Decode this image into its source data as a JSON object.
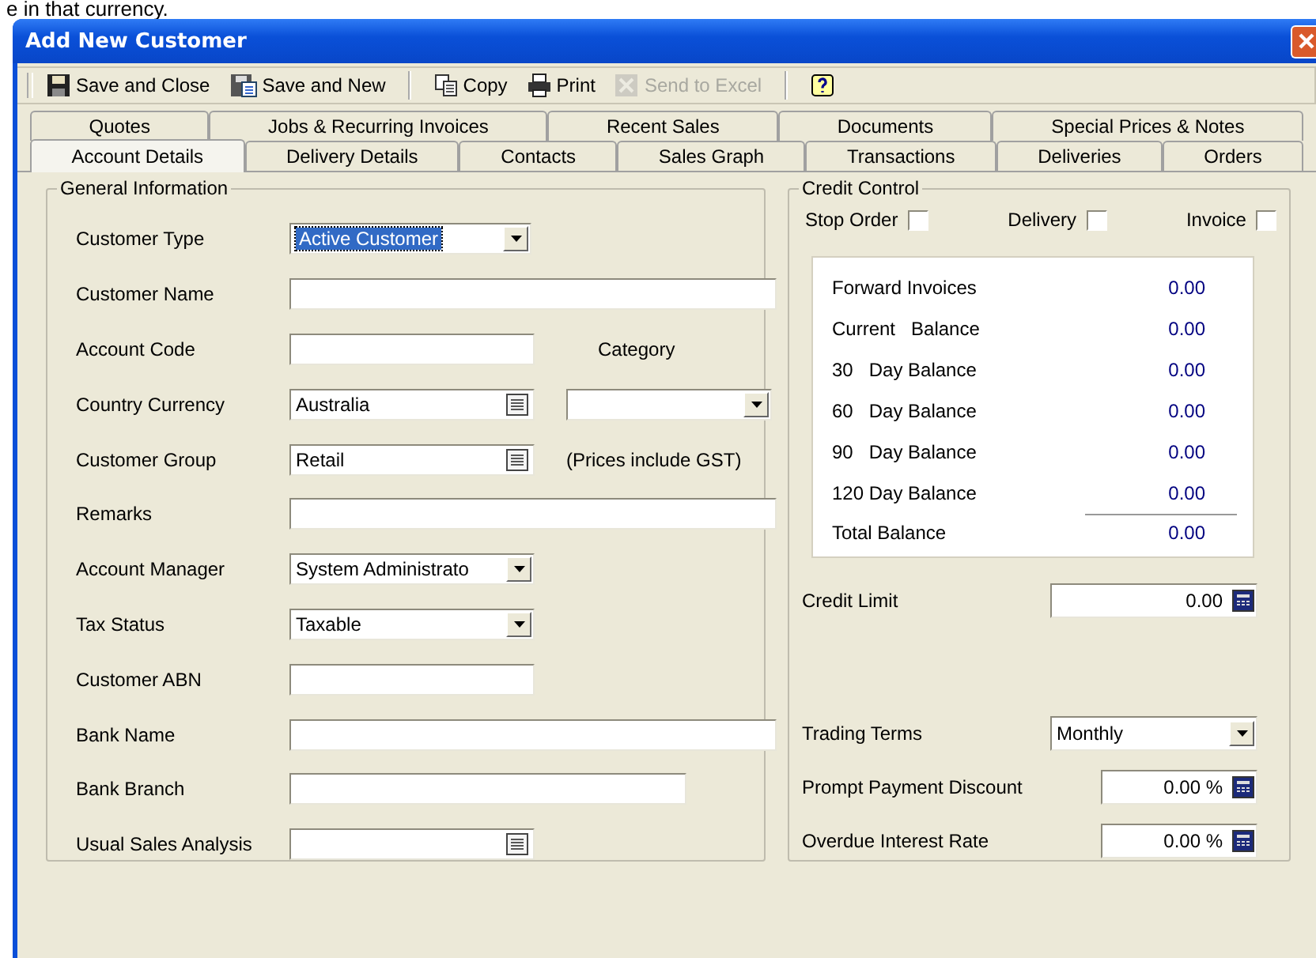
{
  "caption_fragment": "e in that currency.",
  "window": {
    "title": "Add New Customer"
  },
  "toolbar": [
    {
      "kind": "button",
      "label": "Save and Close",
      "disabled": false
    },
    {
      "kind": "button",
      "label": "Save and New",
      "disabled": false
    },
    {
      "kind": "separator"
    },
    {
      "kind": "button",
      "label": "Copy",
      "disabled": false
    },
    {
      "kind": "button",
      "label": "Print",
      "disabled": false
    },
    {
      "kind": "button",
      "label": "Send to Excel",
      "disabled": true
    },
    {
      "kind": "separator"
    },
    {
      "kind": "button",
      "disabled": false
    }
  ],
  "tab_rows": [
    [
      {
        "label": "Quotes",
        "selected": false
      },
      {
        "label": "Jobs & Recurring Invoices",
        "selected": false
      },
      {
        "label": "Recent Sales",
        "selected": false
      },
      {
        "label": "Documents",
        "selected": false
      },
      {
        "label": "Special Prices & Notes",
        "selected": false
      }
    ],
    [
      {
        "label": "Account Details",
        "selected": true
      },
      {
        "label": "Delivery Details",
        "selected": false
      },
      {
        "label": "Contacts",
        "selected": false
      },
      {
        "label": "Sales Graph",
        "selected": false
      },
      {
        "label": "Transactions",
        "selected": false
      },
      {
        "label": "Deliveries",
        "selected": false
      },
      {
        "label": "Orders",
        "selected": false
      }
    ]
  ],
  "general": {
    "title": "General Information",
    "fields": [
      {
        "label": "Customer Type",
        "kind": "dropdown",
        "value": "Active Customer",
        "focused": true
      },
      {
        "label": "Customer Name",
        "kind": "text"
      },
      {
        "label": "Account Code",
        "kind": "text"
      },
      {
        "label": "Country Currency",
        "kind": "lookup",
        "value": "Australia"
      },
      {
        "label": "Customer Group",
        "kind": "lookup",
        "value": "Retail"
      },
      {
        "label": "Remarks",
        "kind": "text"
      },
      {
        "label": "Account Manager",
        "kind": "dropdown",
        "value": "System Administrato",
        "focused": false
      },
      {
        "label": "Tax Status",
        "kind": "dropdown",
        "value": "Taxable",
        "focused": false
      },
      {
        "label": "Customer ABN",
        "kind": "text"
      },
      {
        "label": "Bank Name",
        "kind": "text"
      },
      {
        "label": "Bank Branch",
        "kind": "text"
      },
      {
        "label": "Usual Sales Analysis",
        "kind": "lookup"
      }
    ],
    "category": {
      "label": "Category"
    },
    "price_note": "(Prices include GST)"
  },
  "credit": {
    "title": "Credit Control",
    "flags": [
      {
        "label": "Stop Order",
        "checked": false
      },
      {
        "label": "Delivery",
        "checked": false
      },
      {
        "label": "Invoice",
        "checked": false
      }
    ],
    "balances": [
      {
        "label": "Forward Invoices",
        "value": "0.00"
      },
      {
        "label": "Current   Balance",
        "value": "0.00"
      },
      {
        "label": "30   Day Balance",
        "value": "0.00"
      },
      {
        "label": "60   Day Balance",
        "value": "0.00"
      },
      {
        "label": "90   Day Balance",
        "value": "0.00"
      },
      {
        "label": "120 Day Balance",
        "value": "0.00"
      }
    ],
    "total": {
      "label": "Total Balance",
      "value": "0.00"
    },
    "credit_limit": {
      "label": "Credit Limit",
      "value": "0.00"
    },
    "trading_terms": {
      "label": "Trading Terms",
      "value": "Monthly"
    },
    "prompt_discount": {
      "label": "Prompt Payment Discount",
      "value": "0.00 %"
    },
    "overdue_rate": {
      "label": "Overdue Interest Rate",
      "value": "0.00 %"
    }
  }
}
